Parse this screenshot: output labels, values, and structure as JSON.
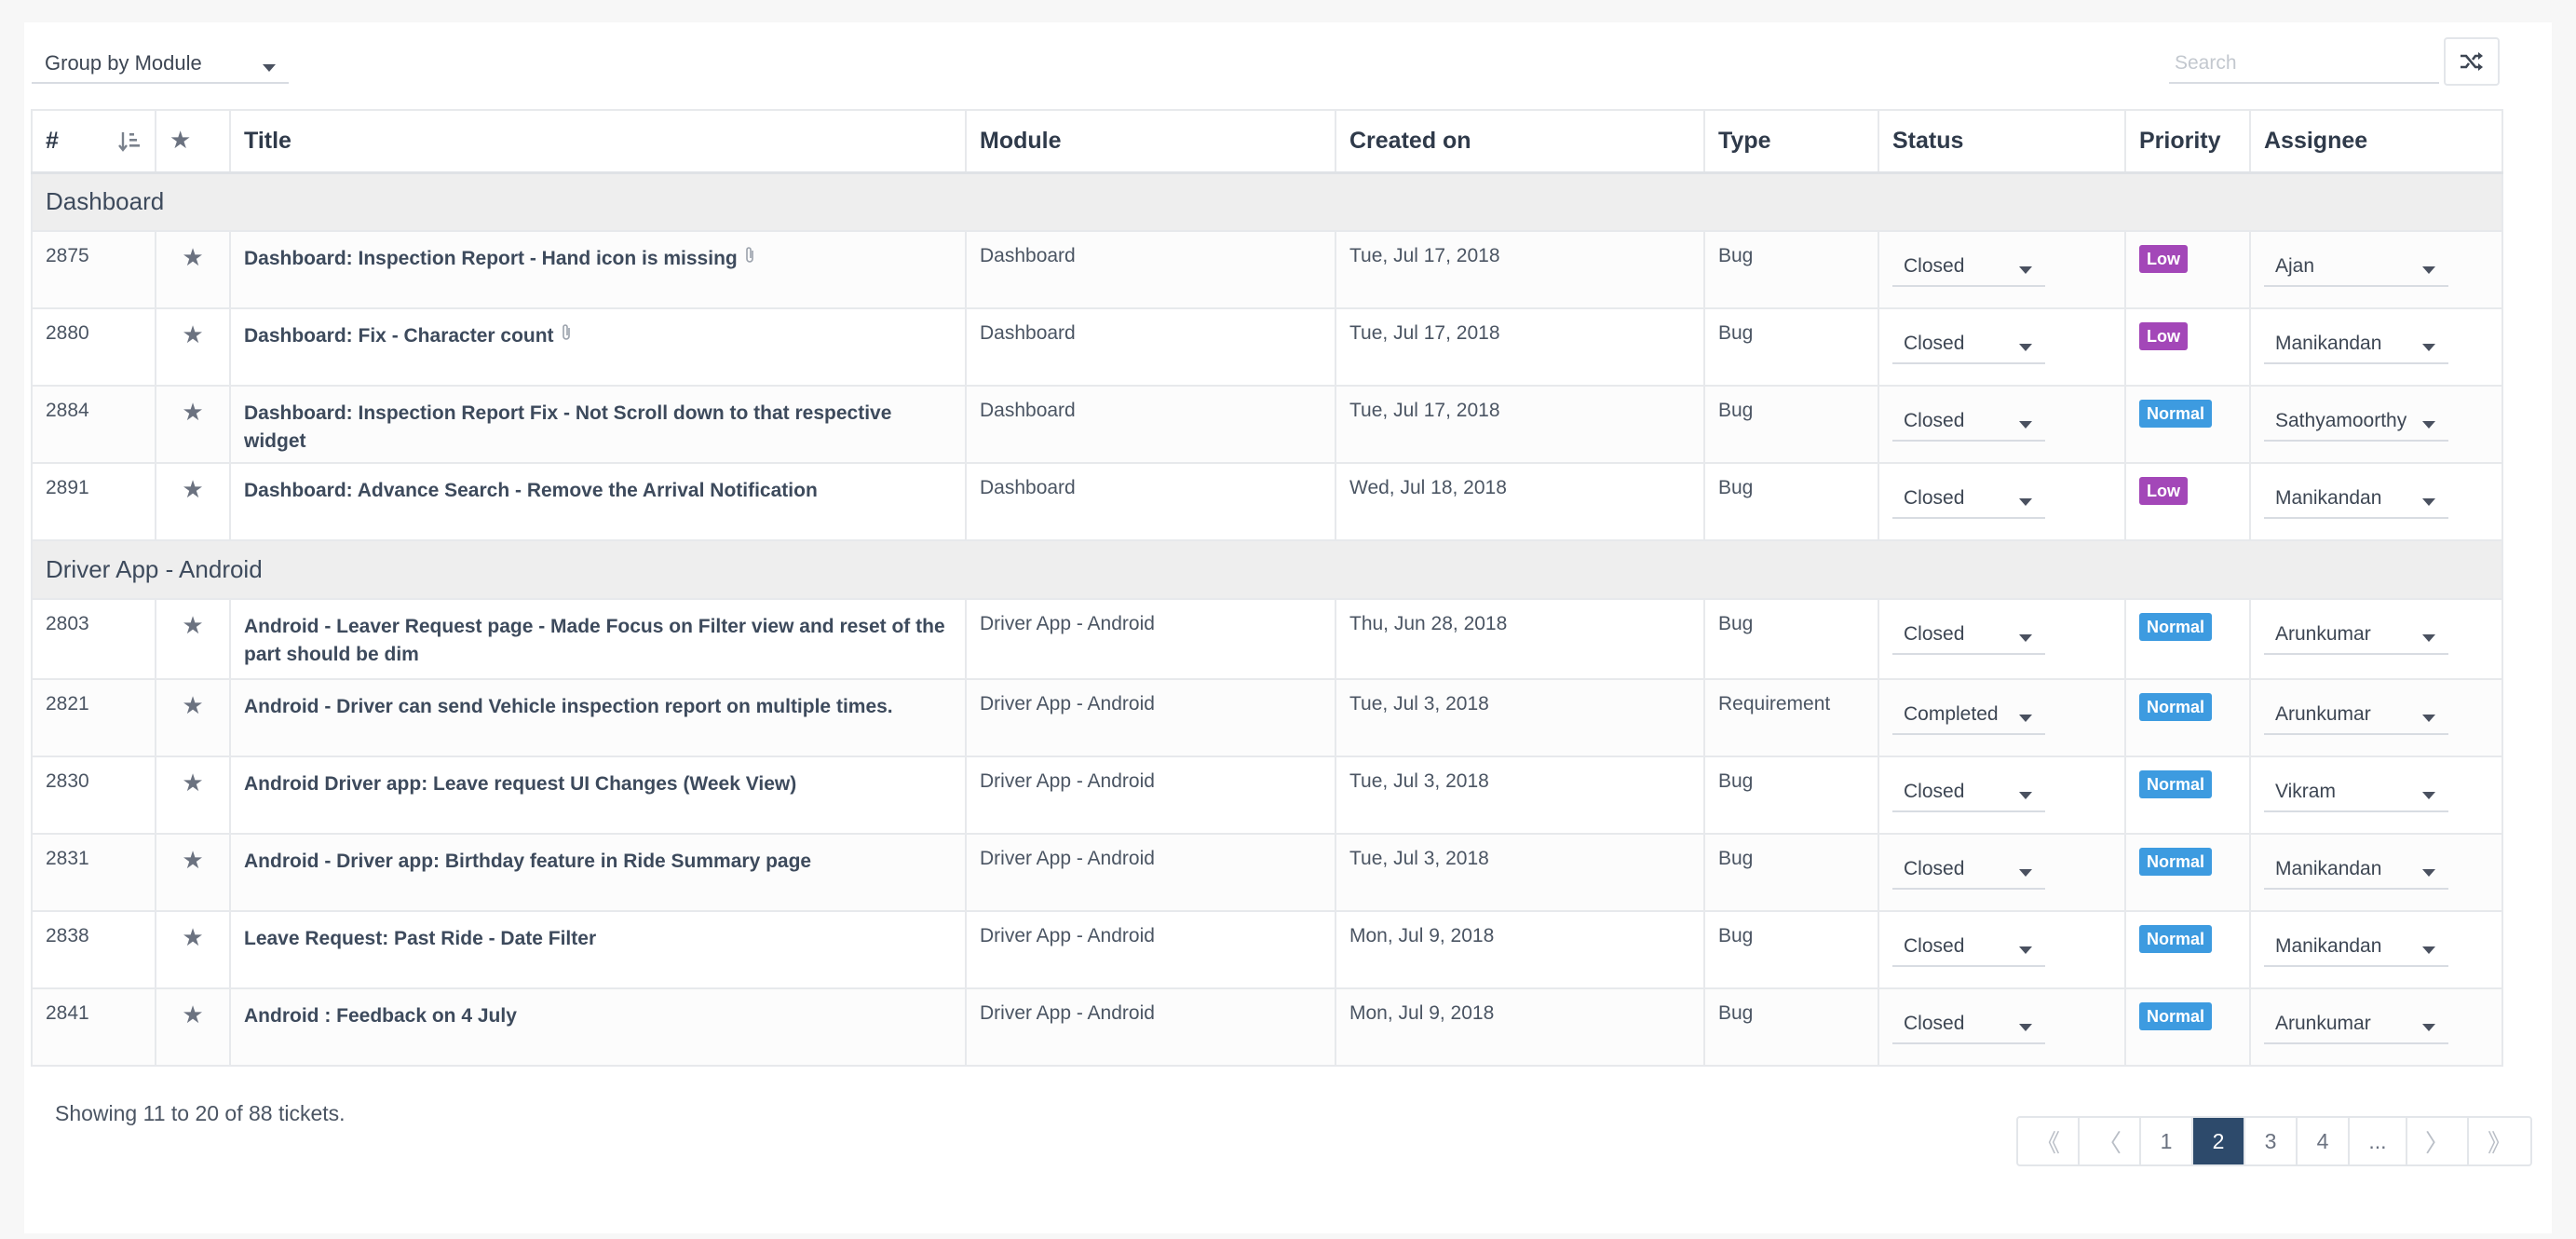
{
  "toolbar": {
    "group_by_label": "Group by Module",
    "search_placeholder": "Search"
  },
  "columns": [
    "#",
    "Title",
    "Module",
    "Created on",
    "Type",
    "Status",
    "Priority",
    "Assignee"
  ],
  "groups": [
    {
      "name": "Dashboard",
      "tickets": [
        {
          "id": "2875",
          "title": "Dashboard: Inspection Report - Hand icon is missing",
          "attachment": true,
          "module": "Dashboard",
          "created": "Tue, Jul 17, 2018",
          "type": "Bug",
          "status": "Closed",
          "priority": "Low",
          "assignee": "Ajan"
        },
        {
          "id": "2880",
          "title": "Dashboard: Fix - Character count",
          "attachment": true,
          "module": "Dashboard",
          "created": "Tue, Jul 17, 2018",
          "type": "Bug",
          "status": "Closed",
          "priority": "Low",
          "assignee": "Manikandan"
        },
        {
          "id": "2884",
          "title": "Dashboard: Inspection Report Fix - Not Scroll down to that respective widget",
          "attachment": false,
          "module": "Dashboard",
          "created": "Tue, Jul 17, 2018",
          "type": "Bug",
          "status": "Closed",
          "priority": "Normal",
          "assignee": "Sathyamoorthy"
        },
        {
          "id": "2891",
          "title": "Dashboard: Advance Search - Remove the Arrival Notification",
          "attachment": false,
          "module": "Dashboard",
          "created": "Wed, Jul 18, 2018",
          "type": "Bug",
          "status": "Closed",
          "priority": "Low",
          "assignee": "Manikandan"
        }
      ]
    },
    {
      "name": "Driver App - Android",
      "tickets": [
        {
          "id": "2803",
          "title": "Android - Leaver Request page - Made Focus on Filter view and reset of the part should be dim",
          "attachment": false,
          "module": "Driver App - Android",
          "created": "Thu, Jun 28, 2018",
          "type": "Bug",
          "status": "Closed",
          "priority": "Normal",
          "assignee": "Arunkumar"
        },
        {
          "id": "2821",
          "title": "Android - Driver can send Vehicle inspection report on multiple times.",
          "attachment": false,
          "module": "Driver App - Android",
          "created": "Tue, Jul 3, 2018",
          "type": "Requirement",
          "status": "Completed",
          "priority": "Normal",
          "assignee": "Arunkumar"
        },
        {
          "id": "2830",
          "title": "Android Driver app: Leave request UI Changes (Week View)",
          "attachment": false,
          "module": "Driver App - Android",
          "created": "Tue, Jul 3, 2018",
          "type": "Bug",
          "status": "Closed",
          "priority": "Normal",
          "assignee": "Vikram"
        },
        {
          "id": "2831",
          "title": "Android - Driver app: Birthday feature in Ride Summary page",
          "attachment": false,
          "module": "Driver App - Android",
          "created": "Tue, Jul 3, 2018",
          "type": "Bug",
          "status": "Closed",
          "priority": "Normal",
          "assignee": "Manikandan"
        },
        {
          "id": "2838",
          "title": "Leave Request: Past Ride - Date Filter",
          "attachment": false,
          "module": "Driver App - Android",
          "created": "Mon, Jul 9, 2018",
          "type": "Bug",
          "status": "Closed",
          "priority": "Normal",
          "assignee": "Manikandan"
        },
        {
          "id": "2841",
          "title": "Android : Feedback on 4 July",
          "attachment": false,
          "module": "Driver App - Android",
          "created": "Mon, Jul 9, 2018",
          "type": "Bug",
          "status": "Closed",
          "priority": "Normal",
          "assignee": "Arunkumar"
        }
      ]
    }
  ],
  "priority_colors": {
    "Low": "#a347b8",
    "Normal": "#3d9be0"
  },
  "icons": {
    "shuffle": "shuffle-icon",
    "sort": "sort-ascending-icon",
    "star": "star-icon",
    "attachment": "paperclip-icon",
    "caret": "caret-down-icon"
  },
  "footer": {
    "summary": "Showing 11 to 20 of 88 tickets."
  },
  "pagination": {
    "first": "《",
    "prev": "〈",
    "next": "〉",
    "last": "》",
    "pages": [
      "1",
      "2",
      "3",
      "4",
      "..."
    ],
    "current": "2"
  }
}
